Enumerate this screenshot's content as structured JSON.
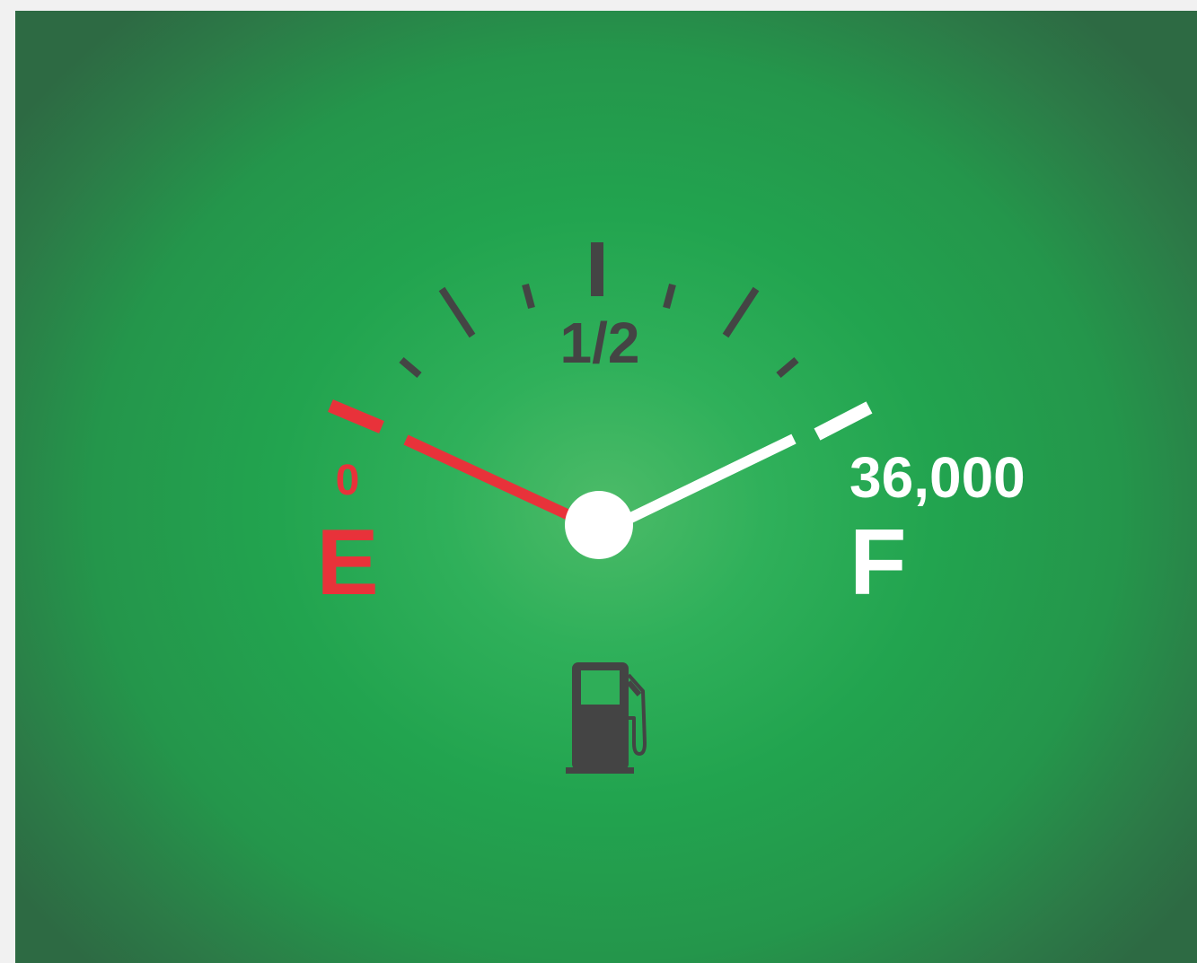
{
  "gauge": {
    "label_half": "1/2",
    "label_empty_value": "0",
    "label_empty": "E",
    "label_full_value": "36,000",
    "label_full": "F",
    "red_needle_level": 0.04,
    "white_needle_level": 0.97
  },
  "icons": {
    "pump": "fuel-pump-icon"
  },
  "colors": {
    "background": "#22a44f",
    "background_center": "#4cbb68",
    "empty_red": "#e8323a",
    "full_white": "#ffffff",
    "tick_dark": "#444444",
    "pump_dark": "#444444"
  }
}
